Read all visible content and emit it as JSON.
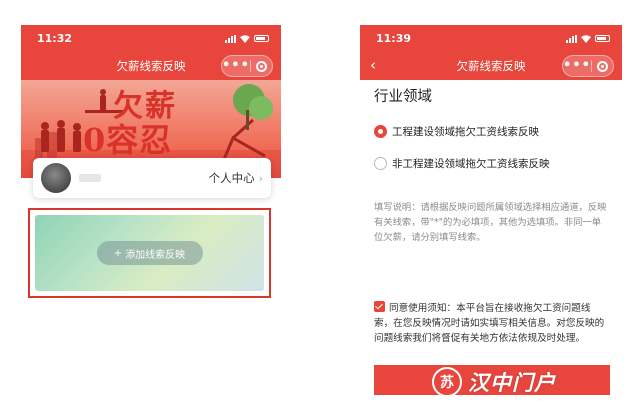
{
  "colors": {
    "brand_red": "#e8453c",
    "highlight_border": "#d8352d"
  },
  "screen1": {
    "status": {
      "time": "11:32"
    },
    "nav": {
      "title": "欠薪线索反映",
      "more": "•••"
    },
    "banner": {
      "line1": "欠薪",
      "line2": "0容忍"
    },
    "user_card": {
      "center_label": "个人中心",
      "chevron": "›"
    },
    "add_button": {
      "icon": "+",
      "label": "添加线索反映"
    }
  },
  "screen2": {
    "status": {
      "time": "11:39"
    },
    "nav": {
      "title": "欠薪线索反映",
      "back": "‹",
      "more": "•••"
    },
    "section_title": "行业领域",
    "options": [
      {
        "label": "工程建设领域拖欠工资线索反映",
        "checked": true
      },
      {
        "label": "非工程建设领域拖欠工资线索反映",
        "checked": false
      }
    ],
    "note": "填写说明：请根据反映问题所属领域选择相应通道，反映有关线索，带\"*\"的为必填项，其他为选填项。非同一单位欠薪，请分别填写线索。",
    "agreement": "同意使用须知：本平台旨在接收拖欠工资问题线索，在您反映情况时请如实填写相关信息。对您反映的问题线索我们将督促有关地方依法依规及时处理。"
  },
  "watermark": {
    "logo_text": "苏",
    "text": "汉中门户"
  },
  "icons": [
    "signal-icon",
    "wifi-icon",
    "battery-icon",
    "more-dots-icon",
    "target-icon",
    "back-chevron-icon",
    "chevron-right-icon",
    "plus-icon",
    "radio-icon",
    "checkbox-icon",
    "watermark-logo-icon"
  ]
}
